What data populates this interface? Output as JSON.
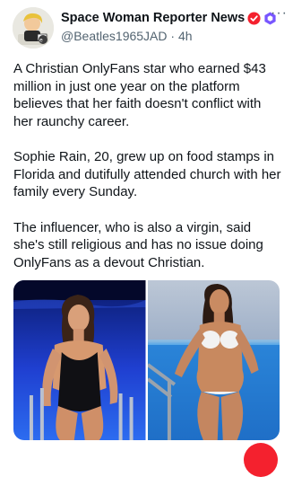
{
  "author": {
    "display_name": "Space Woman Reporter News",
    "handle": "@Beatles1965JAD",
    "time": "4h"
  },
  "icons": {
    "verified": "verified-badge-icon",
    "affiliate": "affiliate-badge-icon",
    "more": "more-options-icon"
  },
  "colors": {
    "verified_badge": "#f4212e",
    "affiliate_badge": "#7856ff",
    "text": "#0f1419",
    "secondary_text": "#536471"
  },
  "post": {
    "paragraphs": [
      "A Christian OnlyFans star who earned $43 million in just one year on the platform believes that her faith doesn't conflict with her raunchy career.",
      "Sophie Rain, 20, grew up on food stamps in Florida and dutifully attended church with her family every Sunday.",
      "The influencer, who is also a virgin, said she's still religious and has no issue doing OnlyFans as a devout Christian."
    ]
  }
}
